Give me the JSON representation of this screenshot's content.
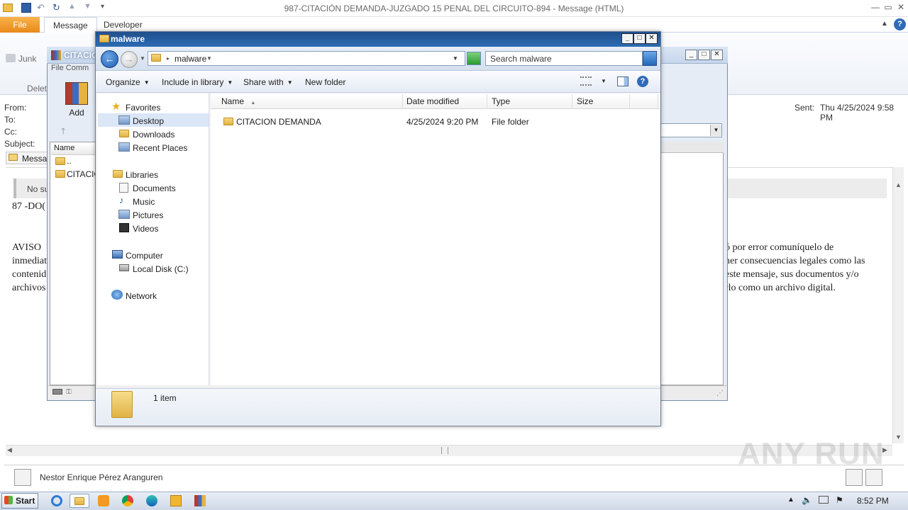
{
  "outlook": {
    "window_title": "987-CITACIÓN  DEMANDA-JUZGADO 15 PENAL DEL CIRCUITO-894 -  Message (HTML)",
    "tabs": [
      "File",
      "Message",
      "Developer"
    ],
    "ribbon": {
      "junk_label": "Junk",
      "delete_group_label": "Delet"
    },
    "headers": {
      "from_label": "From:",
      "to_label": "To:",
      "cc_label": "Cc:",
      "subject_label": "Subject:",
      "sent_label": "Sent:",
      "sent_value": "Thu 4/25/2024 9:58 PM"
    },
    "message_tab_label": "Messag",
    "no_subject_text": "No su",
    "doc_line": "87 -DO(",
    "body_left": [
      "AVISO",
      "inmediat",
      "contenid",
      "archivos"
    ],
    "body_right": [
      "ó por error comuníquelo de",
      "ner consecuencias legales como las",
      "este mensaje, sus documentos y/o",
      "rlo como un archivo digital."
    ],
    "sender_name": "Nestor Enrique Pérez Aranguren"
  },
  "winrar": {
    "title": "CITACIO",
    "menu": "File   Comm",
    "add_label": "Add",
    "column_name": "Name",
    "rows": [
      "..",
      "CITACIO"
    ]
  },
  "explorer": {
    "title": "malware",
    "address_path": "malware",
    "search_placeholder": "Search malware",
    "toolbar": {
      "organize": "Organize",
      "include_in_library": "Include in library",
      "share_with": "Share with",
      "new_folder": "New folder"
    },
    "nav": {
      "favorites": "Favorites",
      "favorites_items": [
        "Desktop",
        "Downloads",
        "Recent Places"
      ],
      "libraries": "Libraries",
      "libraries_items": [
        "Documents",
        "Music",
        "Pictures",
        "Videos"
      ],
      "computer": "Computer",
      "computer_items": [
        "Local Disk (C:)"
      ],
      "network": "Network"
    },
    "columns": [
      "Name",
      "Date modified",
      "Type",
      "Size"
    ],
    "files": [
      {
        "name": "CITACION DEMANDA",
        "date_modified": "4/25/2024 9:20 PM",
        "type": "File folder",
        "size": ""
      }
    ],
    "status": "1 item"
  },
  "taskbar": {
    "start_label": "Start",
    "clock": "8:52 PM"
  },
  "watermark": "ANY RUN",
  "colors": {
    "file_tab": "#e9891a",
    "explorer_title": "#2d6cb4",
    "nav_selected": "#dbe6f6"
  }
}
